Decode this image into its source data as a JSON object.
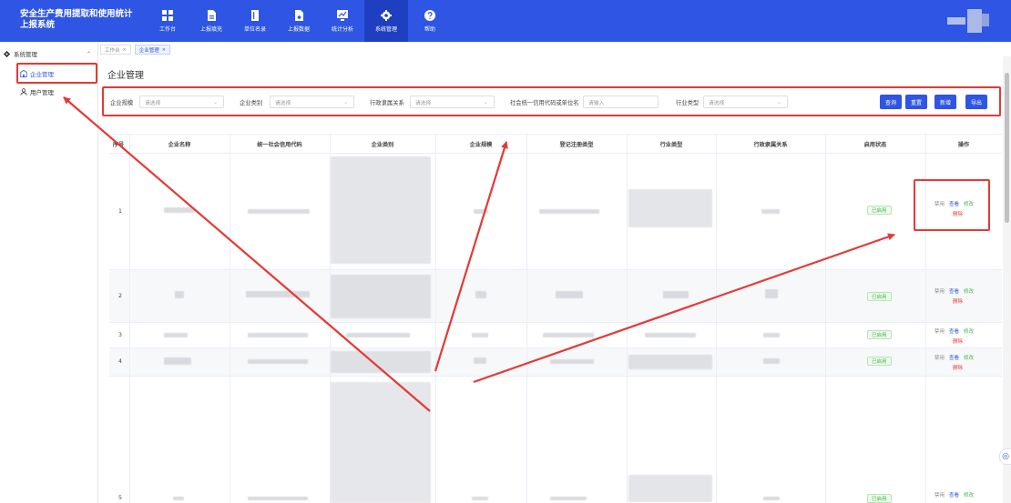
{
  "app": {
    "title": "安全生产费用提取和使用统计上报系统"
  },
  "nav": [
    {
      "label": "工作台",
      "icon": "dashboard-icon"
    },
    {
      "label": "上报填充",
      "icon": "report-fill-icon"
    },
    {
      "label": "单位名录",
      "icon": "directory-icon"
    },
    {
      "label": "上报数据",
      "icon": "report-data-icon"
    },
    {
      "label": "统计分析",
      "icon": "chart-icon"
    },
    {
      "label": "系统管理",
      "icon": "gear-icon",
      "active": true
    },
    {
      "label": "帮助",
      "icon": "help-icon"
    }
  ],
  "sidebar": {
    "group": "系统管理",
    "items": [
      {
        "label": "企业管理",
        "active": true
      },
      {
        "label": "用户管理"
      }
    ]
  },
  "breadcrumb": [
    "工作台",
    "企业管理"
  ],
  "page": {
    "title": "企业管理"
  },
  "filters": {
    "scale_label": "企业规模",
    "scale_placeholder": "请选择",
    "category_label": "企业类别",
    "category_placeholder": "请选择",
    "admin_label": "行政隶属关系",
    "admin_placeholder": "请选择",
    "code_label": "社会统一信用代码或单位名",
    "code_placeholder": "请输入",
    "industry_label": "行业类型",
    "industry_placeholder": "请选择"
  },
  "buttons": {
    "query": "查询",
    "reset": "重置",
    "add": "新增",
    "export": "导出"
  },
  "table": {
    "headers": [
      "序号",
      "企业名称",
      "统一社会信用代码",
      "企业类别",
      "企业规模",
      "登记注册类型",
      "行业类型",
      "行政隶属关系",
      "启用状态",
      "操作"
    ],
    "rows": [
      {
        "index": "1",
        "status": "已启用"
      },
      {
        "index": "2",
        "status": "已启用"
      },
      {
        "index": "3",
        "status": "已启用"
      },
      {
        "index": "4",
        "status": "已启用"
      },
      {
        "index": "5",
        "status": "已启用"
      }
    ],
    "actions": {
      "disable": "禁用",
      "view": "查看",
      "edit": "修改",
      "delete": "删除"
    }
  },
  "colors": {
    "primary": "#2f55e4",
    "highlight": "#e53935",
    "success": "#49b44a"
  }
}
